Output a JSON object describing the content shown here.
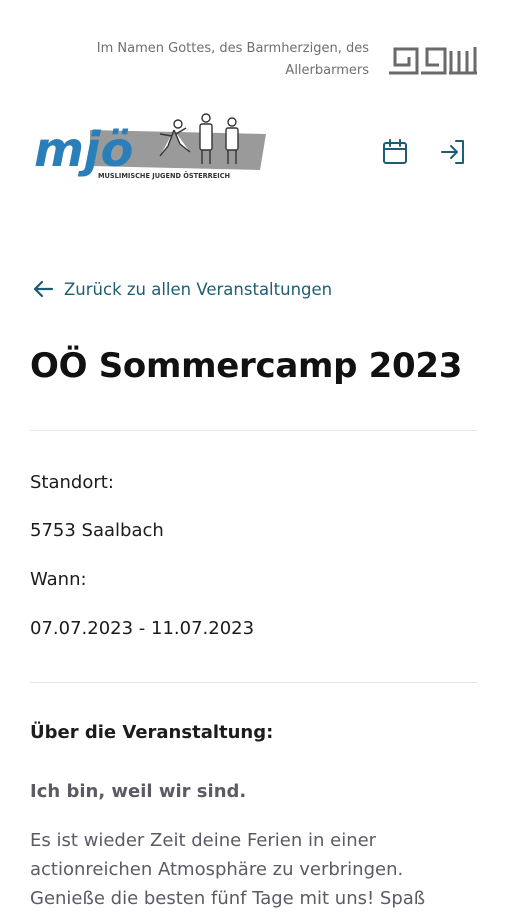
{
  "header": {
    "basmala": "Im Namen Gottes, des Barmherzigen, des Allerbarmers",
    "logo_text": "mjö",
    "logo_subtitle": "MUSLIMISCHE JUGEND ÖSTERREICH",
    "icons": [
      "calendar-icon",
      "login-icon"
    ]
  },
  "nav": {
    "back_label": "Zurück zu allen Veranstaltungen"
  },
  "event": {
    "title": "OÖ Sommercamp 2023",
    "location_label": "Standort:",
    "location_value": "5753 Saalbach",
    "date_label": "Wann:",
    "date_value": "07.07.2023 - 11.07.2023"
  },
  "about": {
    "heading": "Über die Veranstaltung:",
    "tagline": "Ich bin, weil wir sind.",
    "description": "Es ist wieder Zeit deine Ferien in einer actionreichen Atmosphäre zu verbringen. Genieße die besten fünf Tage mit uns! Spaß"
  },
  "colors": {
    "accent": "#1f5d74",
    "logo_blue": "#2b7fb8",
    "logo_grey": "#9a9a9a",
    "text": "#1c1c1c",
    "muted": "#5b5b66"
  }
}
